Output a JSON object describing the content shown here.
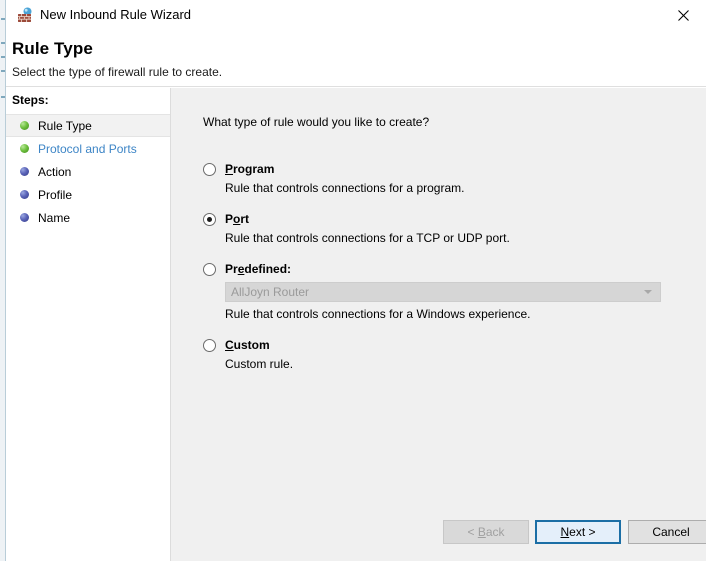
{
  "window": {
    "title": "New Inbound Rule Wizard",
    "icon": "firewall-wizard-icon",
    "close_glyph": "✕"
  },
  "header": {
    "title": "Rule Type",
    "subtitle": "Select the type of firewall rule to create."
  },
  "sidebar": {
    "label": "Steps:",
    "items": [
      {
        "label": "Rule Type",
        "bullet": "green",
        "state": "selected"
      },
      {
        "label": "Protocol and Ports",
        "bullet": "green",
        "state": "link"
      },
      {
        "label": "Action",
        "bullet": "blue",
        "state": "normal"
      },
      {
        "label": "Profile",
        "bullet": "blue",
        "state": "normal"
      },
      {
        "label": "Name",
        "bullet": "blue",
        "state": "normal"
      }
    ]
  },
  "main": {
    "question": "What type of rule would you like to create?",
    "options": [
      {
        "id": "program",
        "label_pre": "",
        "label_key": "P",
        "label_post": "rogram",
        "description": "Rule that controls connections for a program.",
        "selected": false
      },
      {
        "id": "port",
        "label_pre": "P",
        "label_key": "o",
        "label_post": "rt",
        "description": "Rule that controls connections for a TCP or UDP port.",
        "selected": true
      },
      {
        "id": "predefined",
        "label_pre": "Pr",
        "label_key": "e",
        "label_post": "defined:",
        "description": "Rule that controls connections for a Windows experience.",
        "selected": false,
        "combo": {
          "value": "AllJoyn Router",
          "enabled": false
        }
      },
      {
        "id": "custom",
        "label_pre": "",
        "label_key": "C",
        "label_post": "ustom",
        "description": "Custom rule.",
        "selected": false
      }
    ]
  },
  "footer": {
    "back": {
      "pre": "< ",
      "key": "B",
      "post": "ack",
      "enabled": false,
      "default": false
    },
    "next": {
      "pre": "",
      "key": "N",
      "post": "ext >",
      "enabled": true,
      "default": true
    },
    "cancel": {
      "pre": "Cancel",
      "key": "",
      "post": "",
      "enabled": true,
      "default": false
    }
  },
  "colors": {
    "accent": "#1b6ea5",
    "link": "#3d85c6",
    "panel": "#f0f0f0",
    "sidebar": "#ffffff",
    "step_green": "#6fc13f",
    "step_blue": "#5a63b8"
  }
}
